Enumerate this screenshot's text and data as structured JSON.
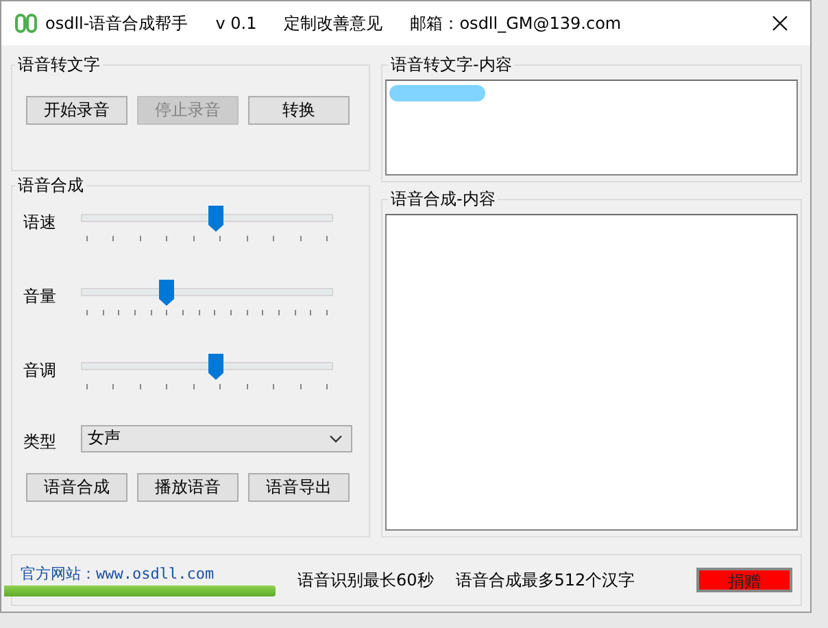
{
  "window": {
    "title": "osdll-语音合成帮手",
    "version": "v 0.1",
    "feedback": "定制改善意见",
    "email": "邮箱：osdll_GM@139.com"
  },
  "speech_to_text": {
    "title": "语音转文字",
    "buttons": [
      {
        "label": "开始录音",
        "disabled": false
      },
      {
        "label": "停止录音",
        "disabled": true
      },
      {
        "label": "转换",
        "disabled": false
      }
    ]
  },
  "speech_to_text_content": {
    "title": "语音转文字-内容"
  },
  "synthesis": {
    "title": "语音合成",
    "sliders": [
      {
        "label": "语速",
        "level": 0.54
      },
      {
        "label": "音量",
        "level": 0.33
      },
      {
        "label": "音调",
        "level": 0.54
      }
    ],
    "type_label": "类型",
    "type_value": "女声",
    "buttons": [
      "语音合成",
      "播放语音",
      "语音导出"
    ]
  },
  "synthesis_content": {
    "title": "语音合成-内容"
  },
  "footer": {
    "link": "官方网站：www.osdll.com",
    "notes": [
      "语音识别最长60秒",
      "语音合成最多512个汉字"
    ],
    "donate": "捐赠"
  }
}
